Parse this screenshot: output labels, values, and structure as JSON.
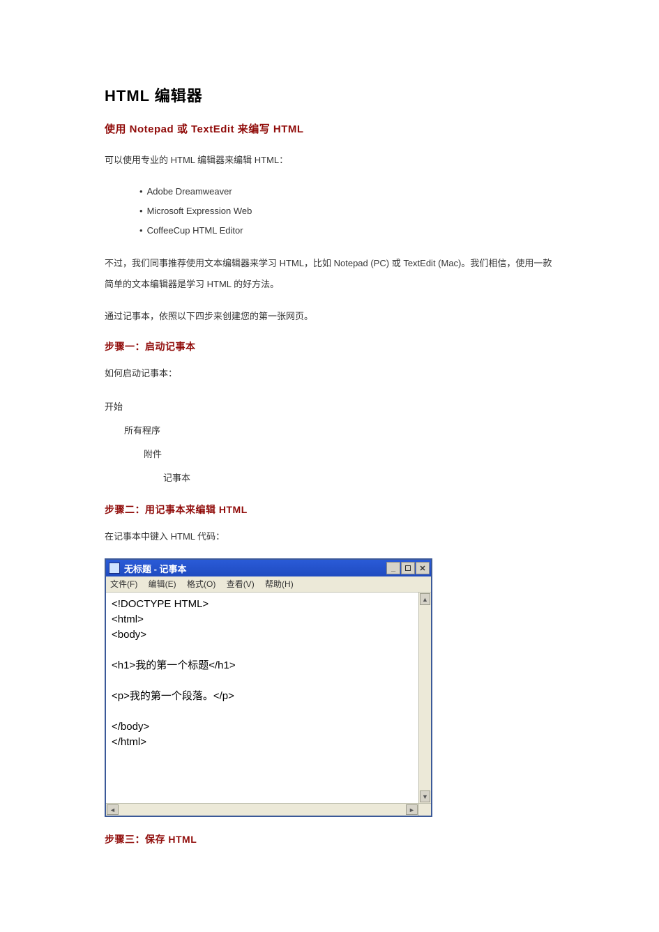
{
  "title": "HTML 编辑器",
  "section1": {
    "heading": "使用 Notepad 或 TextEdit 来编写 HTML",
    "intro": "可以使用专业的 HTML 编辑器来编辑 HTML：",
    "editors": [
      "Adobe Dreamweaver",
      "Microsoft Expression Web",
      "CoffeeCup HTML Editor"
    ],
    "body1": "不过，我们同事推荐使用文本编辑器来学习 HTML，比如 Notepad (PC) 或 TextEdit (Mac)。我们相信，使用一款简单的文本编辑器是学习 HTML 的好方法。",
    "body2": "通过记事本，依照以下四步来创建您的第一张网页。"
  },
  "step1": {
    "heading": "步骤一：启动记事本",
    "body": "如何启动记事本：",
    "path": [
      "开始",
      "所有程序",
      "附件",
      "记事本"
    ]
  },
  "step2": {
    "heading": "步骤二：用记事本来编辑 HTML",
    "body": "在记事本中键入 HTML 代码："
  },
  "notepad": {
    "title": "无标题 - 记事本",
    "menus": {
      "file": "文件(F)",
      "edit": "编辑(E)",
      "format": "格式(O)",
      "view": "查看(V)",
      "help": "帮助(H)"
    },
    "content": "<!DOCTYPE HTML>\n<html>\n<body>\n\n<h1>我的第一个标题</h1>\n\n<p>我的第一个段落。</p>\n\n</body>\n</html>"
  },
  "step3": {
    "heading": "步骤三：保存 HTML"
  }
}
